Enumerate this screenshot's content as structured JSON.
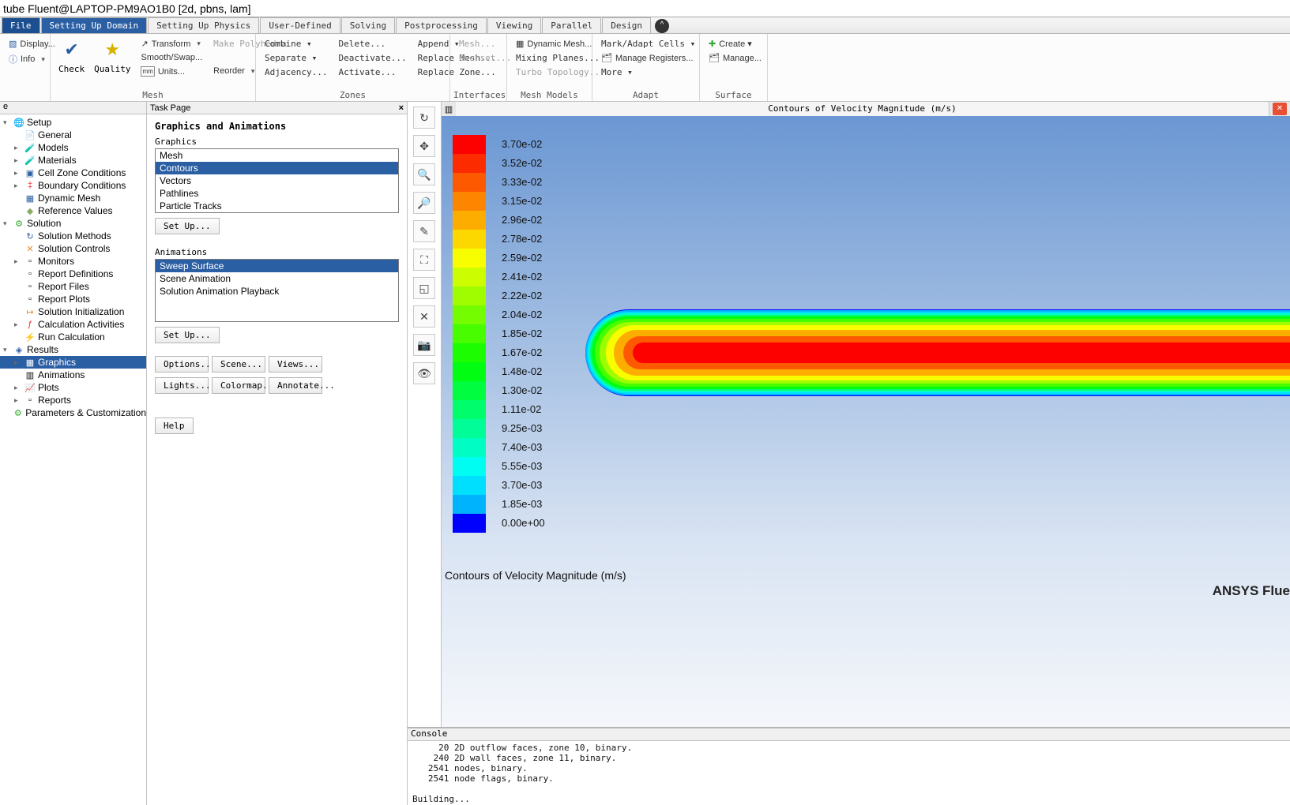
{
  "title": "tube Fluent@LAPTOP-PM9AO1B0  [2d, pbns, lam]",
  "tabs": {
    "file": "File",
    "items": [
      "Setting Up Domain",
      "Setting Up Physics",
      "User-Defined",
      "Solving",
      "Postprocessing",
      "Viewing",
      "Parallel",
      "Design"
    ],
    "active": "Setting Up Domain"
  },
  "ribbon": {
    "r0": {
      "display": "Display...",
      "info": "Info"
    },
    "mesh": {
      "label": "Mesh",
      "check": "Check",
      "quality": "Quality",
      "transform": "Transform",
      "smooth": "Smooth/Swap...",
      "poly": "Make Polyhedra",
      "units": "Units...",
      "reorder": "Reorder"
    },
    "zones": {
      "label": "Zones",
      "c": [
        [
          "Combine ▾",
          "Delete...",
          "Append ▾"
        ],
        [
          "Separate ▾",
          "Deactivate...",
          "Replace Mesh..."
        ],
        [
          "Adjacency...",
          "Activate...",
          "Replace Zone..."
        ]
      ]
    },
    "interfaces": {
      "label": "Interfaces",
      "mesh": "Mesh...",
      "overset": "Overset..."
    },
    "meshmodels": {
      "label": "Mesh Models",
      "dyn": "Dynamic Mesh...",
      "mix": "Mixing Planes...",
      "turbo": "Turbo Topology..."
    },
    "adapt": {
      "label": "Adapt",
      "mark": "Mark/Adapt Cells ▾",
      "manage": "Manage Registers...",
      "more": "More ▾"
    },
    "surface": {
      "label": "Surface",
      "create": "Create ▾",
      "manage": "Manage..."
    }
  },
  "tree": {
    "head": "e",
    "items": [
      {
        "ic": "🌐",
        "c": "c-blue",
        "t": "Setup",
        "e": "▾"
      },
      {
        "ic": "📄",
        "c": "",
        "t": "General",
        "ind": 1
      },
      {
        "ic": "🧪",
        "c": "c-orange",
        "t": "Models",
        "e": "▸",
        "ind": 1
      },
      {
        "ic": "🧪",
        "c": "c-blue",
        "t": "Materials",
        "e": "▸",
        "ind": 1
      },
      {
        "ic": "▣",
        "c": "c-blue",
        "t": "Cell Zone Conditions",
        "e": "▸",
        "ind": 1
      },
      {
        "ic": "‡",
        "c": "c-red",
        "t": "Boundary Conditions",
        "e": "▸",
        "ind": 1
      },
      {
        "ic": "▦",
        "c": "c-blue",
        "t": "Dynamic Mesh",
        "ind": 1
      },
      {
        "ic": "◆",
        "c": "c-purple",
        "t": "Reference Values",
        "ind": 1
      },
      {
        "ic": "⚙",
        "c": "c-green",
        "t": "Solution",
        "e": "▾"
      },
      {
        "ic": "↻",
        "c": "c-blue",
        "t": "Solution Methods",
        "ind": 1
      },
      {
        "ic": "✕",
        "c": "c-orange",
        "t": "Solution Controls",
        "ind": 1
      },
      {
        "ic": "▫",
        "c": "",
        "t": "Monitors",
        "e": "▸",
        "ind": 1
      },
      {
        "ic": "▫",
        "c": "",
        "t": "Report Definitions",
        "ind": 1
      },
      {
        "ic": "▫",
        "c": "",
        "t": "Report Files",
        "ind": 1
      },
      {
        "ic": "▫",
        "c": "",
        "t": "Report Plots",
        "ind": 1
      },
      {
        "ic": "↦",
        "c": "c-orange",
        "t": "Solution Initialization",
        "ind": 1
      },
      {
        "ic": "ƒ",
        "c": "c-red",
        "t": "Calculation Activities",
        "e": "▸",
        "ind": 1
      },
      {
        "ic": "⚡",
        "c": "c-yellow",
        "t": "Run Calculation",
        "ind": 1
      },
      {
        "ic": "◈",
        "c": "c-blue",
        "t": "Results",
        "e": "▾"
      },
      {
        "ic": "▦",
        "c": "",
        "t": "Graphics",
        "e": "▸",
        "ind": 1,
        "sel": true
      },
      {
        "ic": "▥",
        "c": "",
        "t": "Animations",
        "ind": 1
      },
      {
        "ic": "📈",
        "c": "",
        "t": "Plots",
        "e": "▸",
        "ind": 1
      },
      {
        "ic": "▫",
        "c": "",
        "t": "Reports",
        "e": "▸",
        "ind": 1
      },
      {
        "ic": "⚙",
        "c": "c-green",
        "t": "Parameters & Customization"
      }
    ]
  },
  "task": {
    "head": "Task Page",
    "title": "Graphics and Animations",
    "graphics_label": "Graphics",
    "graphics": [
      "Mesh",
      "Contours",
      "Vectors",
      "Pathlines",
      "Particle Tracks"
    ],
    "graphics_sel": "Contours",
    "anim_label": "Animations",
    "anim": [
      "Sweep Surface",
      "Scene Animation",
      "Solution Animation Playback"
    ],
    "anim_sel": "Sweep Surface",
    "setup": "Set Up...",
    "btns": [
      "Options...",
      "Scene...",
      "Views...",
      "Lights...",
      "Colormap...",
      "Annotate..."
    ],
    "help": "Help"
  },
  "viewport": {
    "tab": "Contours of Velocity Magnitude (m/s)",
    "caption": "Contours of Velocity Magnitude (m/s)",
    "brand": "ANSYS Flue",
    "legend": [
      "3.70e-02",
      "3.52e-02",
      "3.33e-02",
      "3.15e-02",
      "2.96e-02",
      "2.78e-02",
      "2.59e-02",
      "2.41e-02",
      "2.22e-02",
      "2.04e-02",
      "1.85e-02",
      "1.67e-02",
      "1.48e-02",
      "1.30e-02",
      "1.11e-02",
      "9.25e-03",
      "7.40e-03",
      "5.55e-03",
      "3.70e-03",
      "1.85e-03",
      "0.00e+00"
    ],
    "colors": [
      "#fd0000",
      "#fd2c00",
      "#fd5900",
      "#fd8500",
      "#fdad00",
      "#fdd800",
      "#f8fd00",
      "#ccfd00",
      "#a0fd00",
      "#73fd00",
      "#47fd00",
      "#1bfd00",
      "#00fd12",
      "#00fd3f",
      "#00fd6b",
      "#00fd98",
      "#00fdc4",
      "#00fdf1",
      "#00dffd",
      "#00b3fd",
      "#0000fd"
    ]
  },
  "console": {
    "head": "Console",
    "text": "     20 2D outflow faces, zone 10, binary.\n    240 2D wall faces, zone 11, binary.\n   2541 nodes, binary.\n   2541 node flags, binary.\n\nBuilding..."
  }
}
